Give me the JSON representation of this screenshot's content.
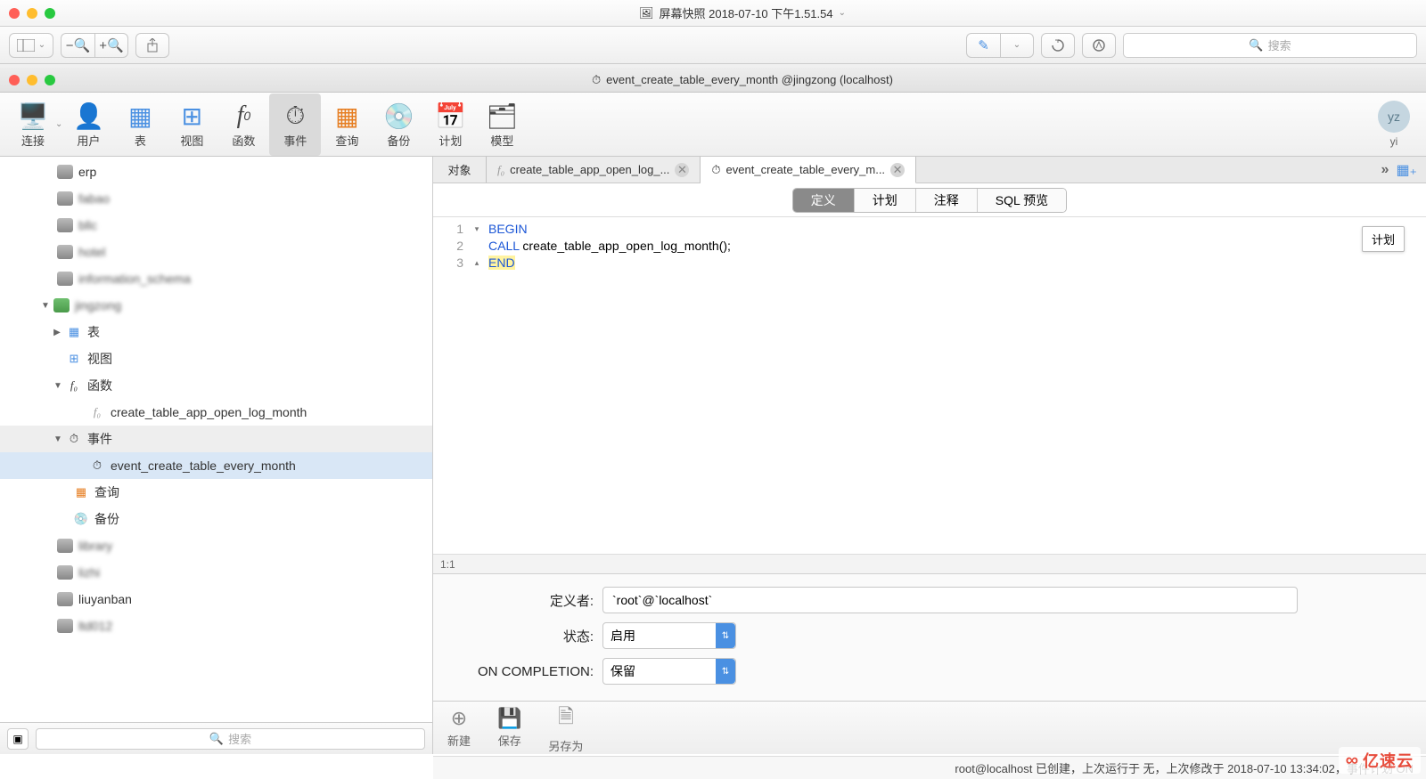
{
  "outer": {
    "title": "屏幕快照 2018-07-10 下午1.51.54",
    "search_placeholder": "搜索"
  },
  "inner": {
    "title": "event_create_table_every_month @jingzong (localhost)"
  },
  "main_toolbar": {
    "items": [
      {
        "label": "连接"
      },
      {
        "label": "用户"
      },
      {
        "label": "表"
      },
      {
        "label": "视图"
      },
      {
        "label": "函数"
      },
      {
        "label": "事件"
      },
      {
        "label": "查询"
      },
      {
        "label": "备份"
      },
      {
        "label": "计划"
      },
      {
        "label": "模型"
      }
    ],
    "avatar": {
      "initials": "yz",
      "label": "yi"
    }
  },
  "sidebar": {
    "items": [
      {
        "label": "erp",
        "type": "db"
      },
      {
        "label": "fabao",
        "type": "db",
        "blur": true
      },
      {
        "label": "bllc",
        "type": "db",
        "blur": true
      },
      {
        "label": "hotel",
        "type": "db",
        "blur": true
      },
      {
        "label": "information_schema",
        "type": "db",
        "blur": true
      },
      {
        "label": "jingzong",
        "type": "db-open",
        "children": [
          {
            "label": "表",
            "icon": "table"
          },
          {
            "label": "视图",
            "icon": "view"
          },
          {
            "label": "函数",
            "icon": "fn",
            "expanded": true,
            "children": [
              {
                "label": "create_table_app_open_log_month",
                "icon": "fn"
              }
            ]
          },
          {
            "label": "事件",
            "icon": "event",
            "expanded": true,
            "selected": true,
            "children": [
              {
                "label": "event_create_table_every_month",
                "icon": "event",
                "selected": true
              }
            ]
          },
          {
            "label": "查询",
            "icon": "query"
          },
          {
            "label": "备份",
            "icon": "backup"
          }
        ]
      },
      {
        "label": "library",
        "type": "db",
        "blur": true
      },
      {
        "label": "lizhi",
        "type": "db",
        "blur": true
      },
      {
        "label": "liuyanban",
        "type": "db",
        "blur": true
      },
      {
        "label": "ltd012",
        "type": "db",
        "blur": true
      }
    ],
    "search_placeholder": "搜索"
  },
  "tabs": {
    "static_tab": "对象",
    "list": [
      {
        "label": "create_table_app_open_log_...",
        "icon": "fn"
      },
      {
        "label": "event_create_table_every_m...",
        "icon": "event",
        "active": true
      }
    ]
  },
  "subtabs": {
    "items": [
      "定义",
      "计划",
      "注释",
      "SQL 预览"
    ],
    "active": 0
  },
  "code": {
    "lines": [
      {
        "n": 1,
        "fold": "▾",
        "tokens": [
          {
            "t": "BEGIN",
            "k": true
          }
        ]
      },
      {
        "n": 2,
        "fold": "",
        "tokens": [
          {
            "t": "CALL",
            "k": true
          },
          {
            "t": " create_table_app_open_log_month();"
          }
        ]
      },
      {
        "n": 3,
        "fold": "▴",
        "tokens": [
          {
            "t": "END",
            "k": true,
            "sel": true
          }
        ]
      }
    ],
    "tooltip": "计划",
    "cursor": "1:1"
  },
  "form": {
    "definer_label": "定义者:",
    "definer_value": "`root`@`localhost`",
    "status_label": "状态:",
    "status_value": "启用",
    "oncompletion_label": "ON COMPLETION:",
    "oncompletion_value": "保留"
  },
  "actions": {
    "items": [
      {
        "label": "新建",
        "icon": "plus"
      },
      {
        "label": "保存",
        "icon": "save"
      },
      {
        "label": "另存为",
        "icon": "saveas"
      }
    ]
  },
  "footer_status": "root@localhost 已创建，上次运行于 无，上次修改于 2018-07-10 13:34:02，事件计划 ON",
  "watermark": "亿速云"
}
